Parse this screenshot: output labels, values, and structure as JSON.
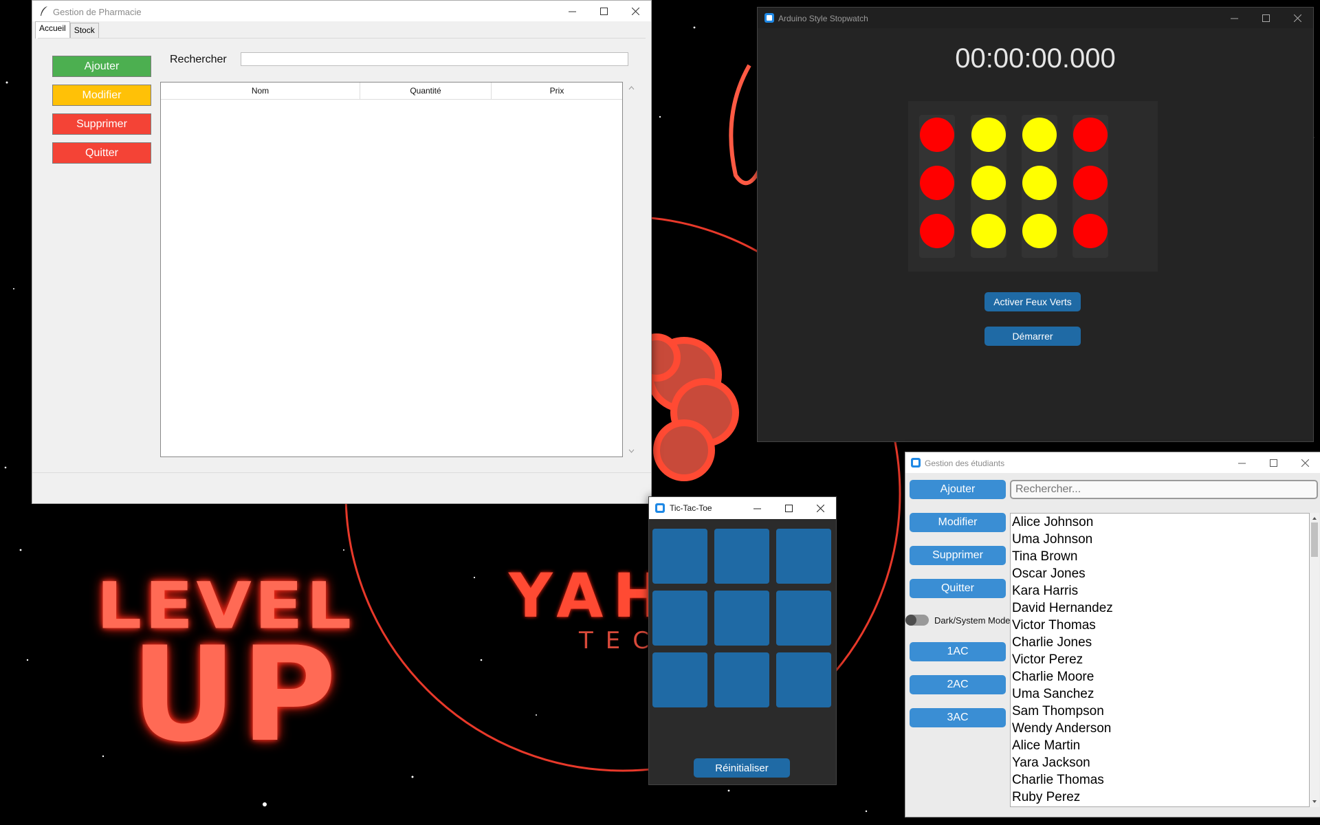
{
  "colors": {
    "success": "#4caf50",
    "warning": "#ffc107",
    "danger": "#f44336",
    "ctk_blue": "#1f6aa5",
    "light_blue": "#3a8ed4",
    "red_light": "#ff0000",
    "yellow_light": "#ffff00"
  },
  "wallpaper": {
    "level": "LEVEL",
    "up": "UP",
    "brand": "YAH",
    "brand_sub": "TECH"
  },
  "pharmacy": {
    "title": "Gestion de Pharmacie",
    "icon": "feather-icon",
    "tabs": [
      "Accueil",
      "Stock"
    ],
    "active_tab": "Accueil",
    "buttons": {
      "add": "Ajouter",
      "edit": "Modifier",
      "delete": "Supprimer",
      "quit": "Quitter"
    },
    "search_label": "Rechercher",
    "search_value": "",
    "table": {
      "columns": [
        "Nom",
        "Quantité",
        "Prix"
      ],
      "rows": []
    }
  },
  "stopwatch": {
    "title": "Arduino Style Stopwatch",
    "time": "00:00:00.000",
    "lights": [
      [
        "red",
        "red",
        "red"
      ],
      [
        "yellow",
        "yellow",
        "yellow"
      ],
      [
        "yellow",
        "yellow",
        "yellow"
      ],
      [
        "red",
        "red",
        "red"
      ]
    ],
    "btn_green": "Activer Feux Verts",
    "btn_start": "Démarrer"
  },
  "tictactoe": {
    "title": "Tic-Tac-Toe",
    "cells": [
      "",
      "",
      "",
      "",
      "",
      "",
      "",
      "",
      ""
    ],
    "reset": "Réinitialiser"
  },
  "students": {
    "title": "Gestion des étudiants",
    "buttons": {
      "add": "Ajouter",
      "edit": "Modifier",
      "delete": "Supprimer",
      "quit": "Quitter",
      "c1": "1AC",
      "c2": "2AC",
      "c3": "3AC"
    },
    "toggle_label": "Dark/System Mode",
    "search_placeholder": "Rechercher...",
    "list": [
      "Alice Johnson",
      "Uma Johnson",
      "Tina Brown",
      "Oscar Jones",
      "Kara Harris",
      "David Hernandez",
      "Victor Thomas",
      "Charlie Jones",
      "Victor Perez",
      "Charlie Moore",
      "Uma Sanchez",
      "Sam Thompson",
      "Wendy Anderson",
      "Alice Martin",
      "Yara Jackson",
      "Charlie Thomas",
      "Ruby Perez"
    ]
  }
}
